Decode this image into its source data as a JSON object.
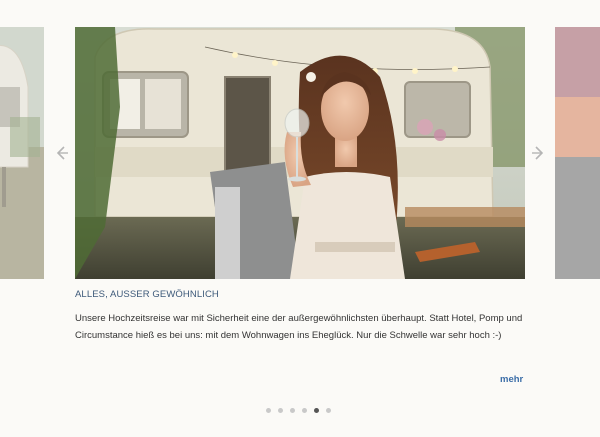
{
  "carousel": {
    "prev_icon": "chevron-left-icon",
    "next_icon": "chevron-right-icon",
    "slide": {
      "image_icon": "photo-bride-caravan",
      "title": "ALLES, AUSSER GEWÖHNLICH",
      "text": "Unsere Hochzeitsreise war mit Sicherheit eine der außergewöhnlichsten überhaupt. Statt Hotel, Pomp und Circumstance hieß es bei uns: mit dem Wohnwagen ins Eheglück. Nur die Schwelle war sehr hoch :-)",
      "more_label": "mehr"
    },
    "dots": [
      {
        "active": false
      },
      {
        "active": false
      },
      {
        "active": false
      },
      {
        "active": false
      },
      {
        "active": true
      },
      {
        "active": false
      }
    ],
    "colors": {
      "title": "#3e5a7a",
      "link": "#3c6ea8",
      "dot": "#c9c9c9",
      "dot_active": "#555555",
      "arrow": "#b5b5b5"
    }
  }
}
